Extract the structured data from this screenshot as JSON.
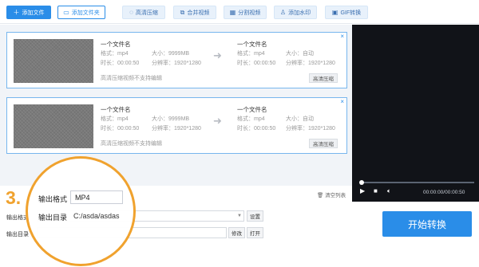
{
  "toolbar": {
    "add_file": "添加文件",
    "add_folder": "添加文件夹",
    "hd_compress": "高清压缩",
    "merge_video": "合并视频",
    "split_video": "分割视频",
    "add_watermark": "添加水印",
    "gif_convert": "GIF转换"
  },
  "files": [
    {
      "source": {
        "name": "一个文件名",
        "format_label": "格式：",
        "format": "mp4",
        "size_label": "大小：",
        "size": "9999MB",
        "duration_label": "时长：",
        "duration": "00:00:50",
        "resolution_label": "分辨率：",
        "resolution": "1920*1280"
      },
      "target": {
        "name": "一个文件名",
        "format_label": "格式：",
        "format": "mp4",
        "size_label": "大小：",
        "size": "自动",
        "duration_label": "时长：",
        "duration": "00:00:50",
        "resolution_label": "分辨率：",
        "resolution": "1920*1280"
      },
      "note": "高清压缩视频不支持编辑",
      "hd_button": "高清压缩"
    },
    {
      "source": {
        "name": "一个文件名",
        "format_label": "格式：",
        "format": "mp4",
        "size_label": "大小：",
        "size": "9999MB",
        "duration_label": "时长：",
        "duration": "00:00:50",
        "resolution_label": "分辨率：",
        "resolution": "1920*1280"
      },
      "target": {
        "name": "一个文件名",
        "format_label": "格式：",
        "format": "mp4",
        "size_label": "大小：",
        "size": "自动",
        "duration_label": "时长：",
        "duration": "00:00:50",
        "resolution_label": "分辨率：",
        "resolution": "1920*1280"
      },
      "note": "高清压缩视频不支持编辑",
      "hd_button": "高清压缩"
    }
  ],
  "player": {
    "time": "00:00:00/00:00:50",
    "progress": 0,
    "icons": [
      "play-icon",
      "stop-icon",
      "volume-icon"
    ]
  },
  "clear_list": "清空列表",
  "settings": {
    "output_format_label": "输出格式",
    "output_dir_label": "输出目录",
    "output_dir_value": "C:/asda/asdas",
    "settings_button": "设置",
    "modify_button": "修改",
    "open_button": "打开"
  },
  "zoom": {
    "step": "3.",
    "format_label": "输出格式",
    "format_value": "MP4",
    "dir_label": "输出目录",
    "dir_value": "C:/asda/asdas"
  },
  "start_button": "开始转换",
  "colors": {
    "accent": "#2a8de8",
    "highlight": "#f0a22e",
    "player_bg": "#111318"
  }
}
